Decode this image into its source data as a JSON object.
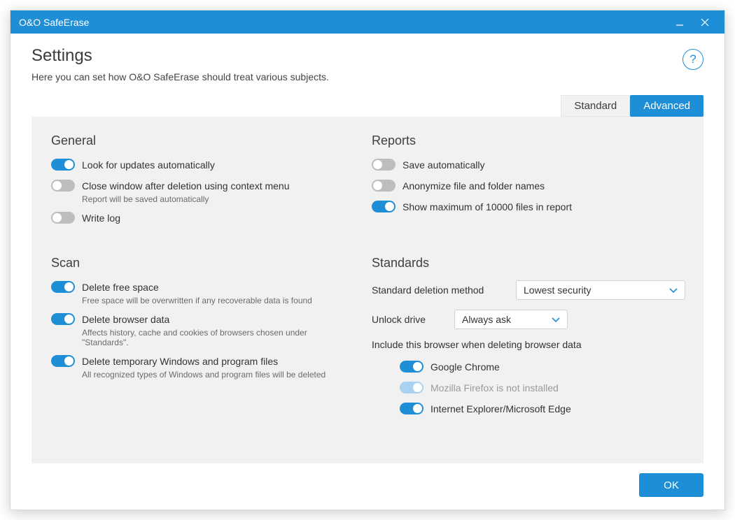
{
  "window": {
    "title": "O&O SafeErase"
  },
  "page": {
    "title": "Settings",
    "subtitle": "Here you can set how O&O SafeErase should treat various subjects."
  },
  "help_glyph": "?",
  "tabs": {
    "standard": "Standard",
    "advanced": "Advanced",
    "active": "advanced"
  },
  "sections": {
    "general": {
      "title": "General",
      "updates": {
        "label": "Look for updates automatically",
        "on": true
      },
      "closewin": {
        "label": "Close window after deletion using context menu",
        "desc": "Report will be saved automatically",
        "on": false
      },
      "writelog": {
        "label": "Write log",
        "on": false
      }
    },
    "reports": {
      "title": "Reports",
      "save_auto": {
        "label": "Save automatically",
        "on": false
      },
      "anonymize": {
        "label": "Anonymize file and folder names",
        "on": false
      },
      "maxfiles": {
        "label": "Show maximum of 10000 files in report",
        "on": true
      }
    },
    "scan": {
      "title": "Scan",
      "freespace": {
        "label": "Delete free space",
        "desc": "Free space will be overwritten if any recoverable data is found",
        "on": true
      },
      "browserdata": {
        "label": "Delete browser data",
        "desc": "Affects history, cache and cookies of browsers chosen under \"Standards\".",
        "on": true
      },
      "tempfiles": {
        "label": "Delete temporary Windows and program files",
        "desc": "All recognized types of Windows and program files will be deleted",
        "on": true
      }
    },
    "standards": {
      "title": "Standards",
      "method_label": "Standard deletion method",
      "method_value": "Lowest security",
      "unlock_label": "Unlock drive",
      "unlock_value": "Always ask",
      "include_note": "Include this browser when deleting browser data",
      "browsers": {
        "chrome": {
          "label": "Google Chrome",
          "on": true,
          "disabled": false
        },
        "firefox": {
          "label": "Mozilla Firefox is not installed",
          "on": true,
          "disabled": true
        },
        "edge": {
          "label": "Internet Explorer/Microsoft Edge",
          "on": true,
          "disabled": false
        }
      }
    }
  },
  "footer": {
    "ok": "OK"
  }
}
